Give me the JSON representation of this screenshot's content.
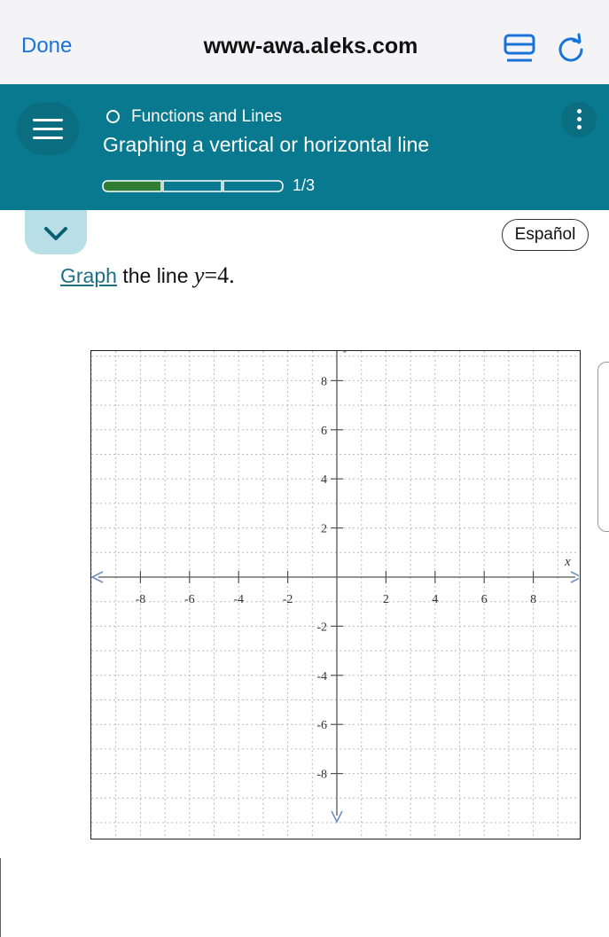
{
  "browser": {
    "done_label": "Done",
    "url": "www-awa.aleks.com"
  },
  "header": {
    "topic": "Functions and Lines",
    "title": "Graphing a vertical or horizontal line",
    "progress_label": "1/3",
    "progress": {
      "completed_segments": 1,
      "total_segments": 3
    }
  },
  "toolbar": {
    "language_label": "Español"
  },
  "question": {
    "link_text": "Graph",
    "text": " the line ",
    "variable": "y",
    "equation_rest": "=4."
  },
  "chart_data": {
    "type": "grid",
    "xlim": [
      -10,
      10
    ],
    "ylim": [
      -10,
      10
    ],
    "grid": true,
    "xlabel": "x",
    "ylabel": "y",
    "x_tick_labels": [
      "-8",
      "-6",
      "-4",
      "-2",
      "2",
      "4",
      "6",
      "8"
    ],
    "y_tick_labels": [
      "8",
      "6",
      "4",
      "2",
      "-2",
      "-4",
      "-6",
      "-8"
    ]
  },
  "colors": {
    "header": "#08798f",
    "link": "#1f6e86",
    "progress_fill": "#2e7d32",
    "axis_arrow": "#6e8ebf"
  }
}
